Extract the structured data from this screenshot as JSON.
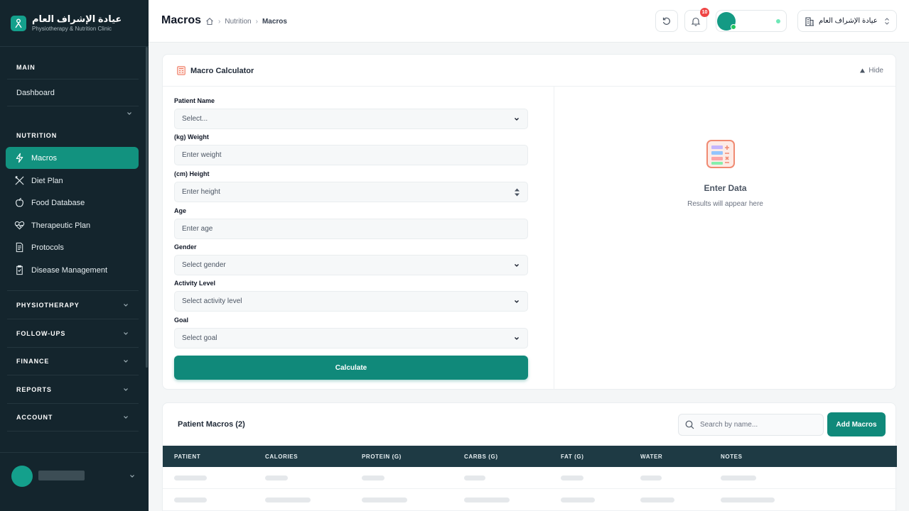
{
  "brand": {
    "name": "عيادة الإشراف العام",
    "subtitle": "Physiotherapy & Nutrition Clinic",
    "accent": "#14a08c"
  },
  "sidebar": {
    "main_label": "MAIN",
    "dashboard": "Dashboard",
    "nutrition_label": "NUTRITION",
    "nutrition_items": [
      {
        "label": "Macros",
        "icon": "bolt-icon",
        "active": true
      },
      {
        "label": "Diet Plan",
        "icon": "utensils-icon"
      },
      {
        "label": "Food Database",
        "icon": "apple-icon"
      },
      {
        "label": "Therapeutic Plan",
        "icon": "heart-pulse-icon"
      },
      {
        "label": "Protocols",
        "icon": "document-icon"
      },
      {
        "label": "Disease Management",
        "icon": "clipboard-icon"
      }
    ],
    "groups": [
      "PHYSIOTHERAPY",
      "FOLLOW-UPS",
      "FINANCE",
      "REPORTS",
      "ACCOUNT"
    ]
  },
  "header": {
    "title": "Macros",
    "breadcrumb": [
      "Nutrition",
      "Macros"
    ],
    "notifications": "10",
    "clinic": "عيادة الإشراف العام"
  },
  "calculator": {
    "title": "Macro Calculator",
    "hide": "Hide",
    "fields": {
      "patient": {
        "label": "Patient Name",
        "placeholder": "Select..."
      },
      "weight": {
        "label": "(kg) Weight",
        "placeholder": "Enter weight"
      },
      "height": {
        "label": "(cm) Height",
        "placeholder": "Enter height"
      },
      "age": {
        "label": "Age",
        "placeholder": "Enter age"
      },
      "gender": {
        "label": "Gender",
        "placeholder": "Select gender"
      },
      "activity": {
        "label": "Activity Level",
        "placeholder": "Select activity level"
      },
      "goal": {
        "label": "Goal",
        "placeholder": "Select goal"
      }
    },
    "calculate": "Calculate",
    "result_title": "Enter Data",
    "result_subtitle": "Results will appear here"
  },
  "macros_list": {
    "title": "Patient Macros (2)",
    "search_placeholder": "Search by name...",
    "add": "Add Macros",
    "columns": [
      "PATIENT",
      "CALORIES",
      "PROTEIN (G)",
      "CARBS (G)",
      "FAT (G)",
      "WATER",
      "NOTES"
    ]
  }
}
